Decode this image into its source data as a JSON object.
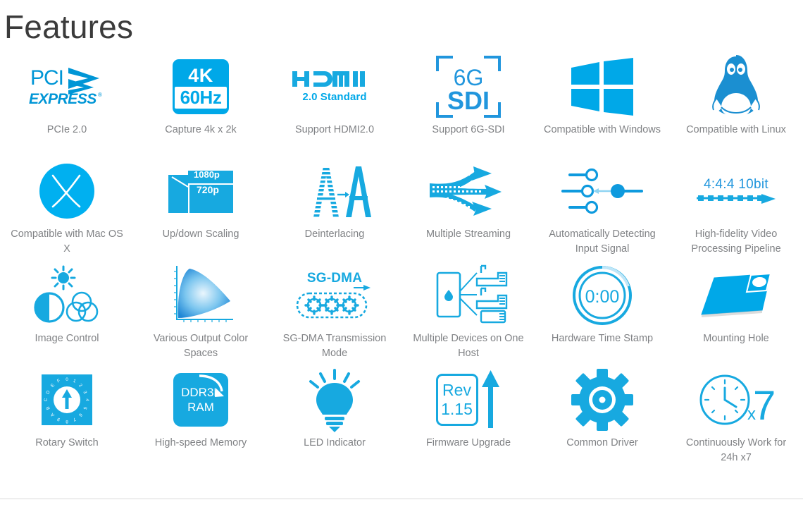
{
  "page": {
    "title": "Features",
    "accent_color": "#17a9e0",
    "accent_color_alt": "#00a8e8",
    "label_color": "#808285",
    "title_color": "#3b3b3b",
    "background": "#ffffff",
    "divider_color": "#d9d9d9"
  },
  "features": [
    {
      "icon": "pci-express-logo-icon",
      "label": "PCIe 2.0",
      "icon_text": {
        "line1": "PCI",
        "line2": "EXPRESS"
      }
    },
    {
      "icon": "4k-60hz-badge-icon",
      "label": "Capture 4k x 2k",
      "icon_text": {
        "line1": "4K",
        "line2": "60Hz"
      }
    },
    {
      "icon": "hdmi-logo-icon",
      "label": "Support HDMI2.0",
      "icon_text": {
        "line1": "HDMI",
        "line2": "2.0 Standard"
      }
    },
    {
      "icon": "6g-sdi-bracket-icon",
      "label": "Support 6G-SDI",
      "icon_text": {
        "line1": "6G",
        "line2": "SDI"
      }
    },
    {
      "icon": "windows-logo-icon",
      "label": "Compatible with Windows"
    },
    {
      "icon": "linux-penguin-icon",
      "label": "Compatible with Linux"
    },
    {
      "icon": "mac-os-x-circle-icon",
      "label": "Compatible with Mac OS X",
      "icon_text": {
        "line1": "X"
      }
    },
    {
      "icon": "up-down-scaling-icon",
      "label": "Up/down Scaling",
      "icon_text": {
        "line1": "1080p",
        "line2": "720p"
      }
    },
    {
      "icon": "deinterlacing-aa-icon",
      "label": "Deinterlacing",
      "icon_text": {
        "line1": "A",
        "line2": "A"
      }
    },
    {
      "icon": "multiple-streaming-arrows-icon",
      "label": "Multiple Streaming"
    },
    {
      "icon": "auto-detect-signal-sliders-icon",
      "label": "Automatically Detecting Input Signal"
    },
    {
      "icon": "high-fidelity-444-10bit-icon",
      "label": "High-fidelity Video Processing Pipeline",
      "icon_text": {
        "line1": "4:4:4 10bit"
      }
    },
    {
      "icon": "image-control-brightness-icon",
      "label": "Image Control"
    },
    {
      "icon": "color-gamut-chart-icon",
      "label": "Various Output Color Spaces"
    },
    {
      "icon": "sg-dma-gears-icon",
      "label": "SG-DMA Transmission Mode",
      "icon_text": {
        "line1": "SG-DMA"
      }
    },
    {
      "icon": "multiple-devices-host-icon",
      "label": "Multiple Devices on One Host"
    },
    {
      "icon": "hardware-time-stamp-timer-icon",
      "label": "Hardware Time Stamp",
      "icon_text": {
        "line1": "0:00"
      }
    },
    {
      "icon": "mounting-hole-plate-icon",
      "label": "Mounting Hole"
    },
    {
      "icon": "rotary-switch-dial-icon",
      "label": "Rotary Switch",
      "icon_text": {
        "line1": "0123456789ABCDEF"
      }
    },
    {
      "icon": "ddr3l-ram-badge-icon",
      "label": "High-speed Memory",
      "icon_text": {
        "line1": "DDR3L",
        "line2": "RAM"
      }
    },
    {
      "icon": "led-indicator-bulb-icon",
      "label": "LED Indicator"
    },
    {
      "icon": "firmware-upgrade-rev-icon",
      "label": "Firmware Upgrade",
      "icon_text": {
        "line1": "Rev",
        "line2": "1.15"
      }
    },
    {
      "icon": "common-driver-gear-icon",
      "label": "Common Driver"
    },
    {
      "icon": "clock-x7-icon",
      "label": "Continuously Work for 24h x7",
      "icon_text": {
        "line1": "x",
        "line2": "7"
      }
    }
  ]
}
